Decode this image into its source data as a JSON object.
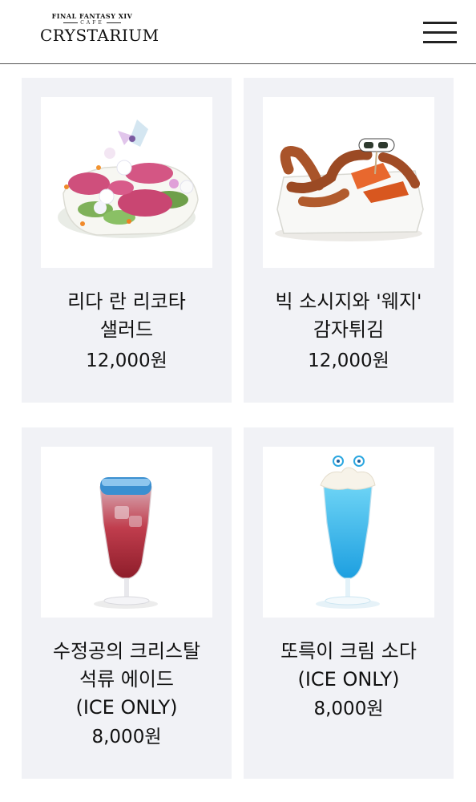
{
  "header": {
    "logo_line1": "FINAL FANTASY XIV",
    "logo_line2": "CAFE",
    "logo_line3": "Crystarium",
    "menu_icon": "hamburger-menu-icon"
  },
  "menu_items": [
    {
      "name_line1": "리다 란 리코타",
      "name_line2": "샐러드",
      "price": "12,000원",
      "image": "ricotta-salad-image"
    },
    {
      "name_line1": "빅 소시지와 '웨지'",
      "name_line2": "감자튀김",
      "price": "12,000원",
      "image": "sausage-wedges-image"
    },
    {
      "name_line1": "수정공의 크리스탈",
      "name_line2": "석류 에이드",
      "name_line3": "(ICE ONLY)",
      "price": "8,000원",
      "image": "pomegranate-ade-image"
    },
    {
      "name_line1": "또륵이 크림 소다",
      "name_line2": "(ICE ONLY)",
      "price": "8,000원",
      "image": "cream-soda-image"
    }
  ],
  "colors": {
    "card_bg": "#f1f2f6",
    "header_border": "#555555"
  }
}
